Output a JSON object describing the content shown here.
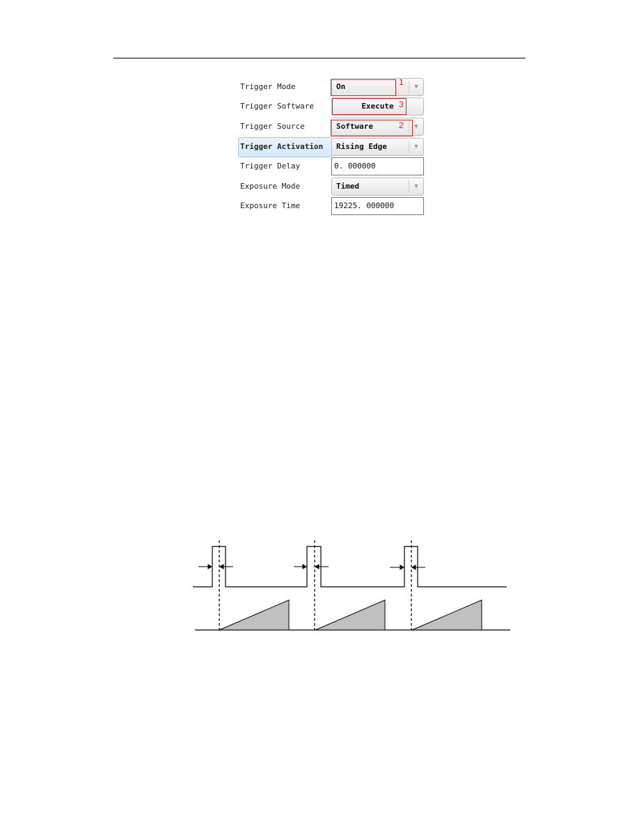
{
  "settings": {
    "rows": [
      {
        "label": "Trigger Mode",
        "value": "On",
        "kind": "dropdown"
      },
      {
        "label": "Trigger Software",
        "value": "Execute",
        "kind": "button"
      },
      {
        "label": "Trigger Source",
        "value": "Software",
        "kind": "dropdown"
      },
      {
        "label": "Trigger Activation",
        "value": "Rising Edge",
        "kind": "dropdown",
        "highlighted": true
      },
      {
        "label": "Trigger Delay",
        "value": "0. 000000",
        "kind": "input"
      },
      {
        "label": "Exposure Mode",
        "value": "Timed",
        "kind": "dropdown"
      },
      {
        "label": "Exposure Time",
        "value": "19225. 000000",
        "kind": "input"
      }
    ],
    "annotations": [
      "1",
      "2",
      "3"
    ],
    "annotation_color": "#e02020",
    "highlight_color": "#d6e8fb"
  }
}
